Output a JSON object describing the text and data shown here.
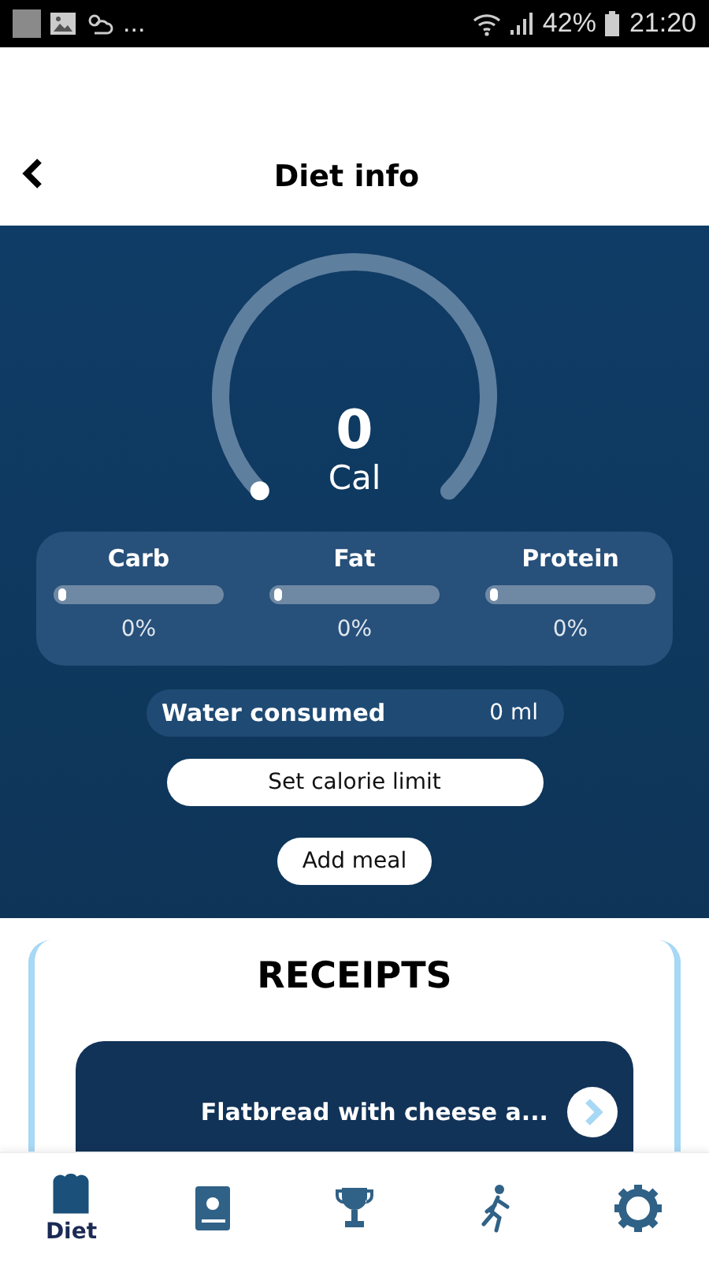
{
  "status_bar": {
    "dots": "...",
    "battery": "42%",
    "time": "21:20"
  },
  "header": {
    "title": "Diet info"
  },
  "gauge": {
    "value": "0",
    "unit": "Cal"
  },
  "macros": [
    {
      "label": "Carb",
      "level": 0,
      "reading": "0%"
    },
    {
      "label": "Fat",
      "level": 0,
      "reading": "0%"
    },
    {
      "label": "Protein",
      "level": 0,
      "reading": "0%"
    }
  ],
  "water": {
    "label": "Water consumed",
    "value": "0 ml"
  },
  "buttons": [
    "Set calorie limit",
    "Add meal"
  ],
  "receipts": {
    "title": "RECEIPTS",
    "items": [
      {
        "title": "Flatbread with cheese a..."
      }
    ]
  },
  "nav": [
    {
      "label": "Diet",
      "selected": true
    },
    {
      "selected": false
    },
    {
      "selected": false
    },
    {
      "selected": false
    },
    {
      "selected": false
    }
  ]
}
